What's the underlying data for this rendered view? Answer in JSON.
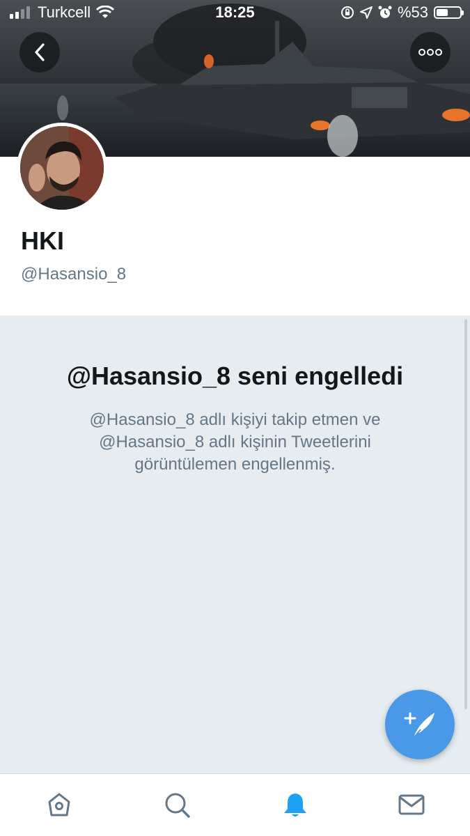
{
  "status_bar": {
    "carrier": "Turkcell",
    "time": "18:25",
    "battery": "%53",
    "battery_level": 0.53
  },
  "header": {
    "back_icon": "chevron-left-icon",
    "more_icon": "more-dots-icon"
  },
  "profile": {
    "name": "HKI",
    "handle": "@Hasansio_8"
  },
  "blocked": {
    "title": "@Hasansio_8 seni engelledi",
    "description": "@Hasansio_8 adlı kişiyi takip etmen ve @Hasansio_8 adlı kişinin Tweetlerini görüntülemen engellenmiş."
  },
  "compose": {
    "icon": "compose-tweet-icon"
  },
  "tabbar": {
    "items": [
      {
        "name": "home",
        "icon": "home-icon"
      },
      {
        "name": "search",
        "icon": "search-icon"
      },
      {
        "name": "notifications",
        "icon": "bell-icon",
        "active": true
      },
      {
        "name": "messages",
        "icon": "mail-icon"
      }
    ]
  },
  "colors": {
    "accent": "#1da1f2",
    "compose": "#4a99e9",
    "text_primary": "#14171a",
    "text_secondary": "#657786",
    "panel_bg": "#e6ecf0"
  }
}
